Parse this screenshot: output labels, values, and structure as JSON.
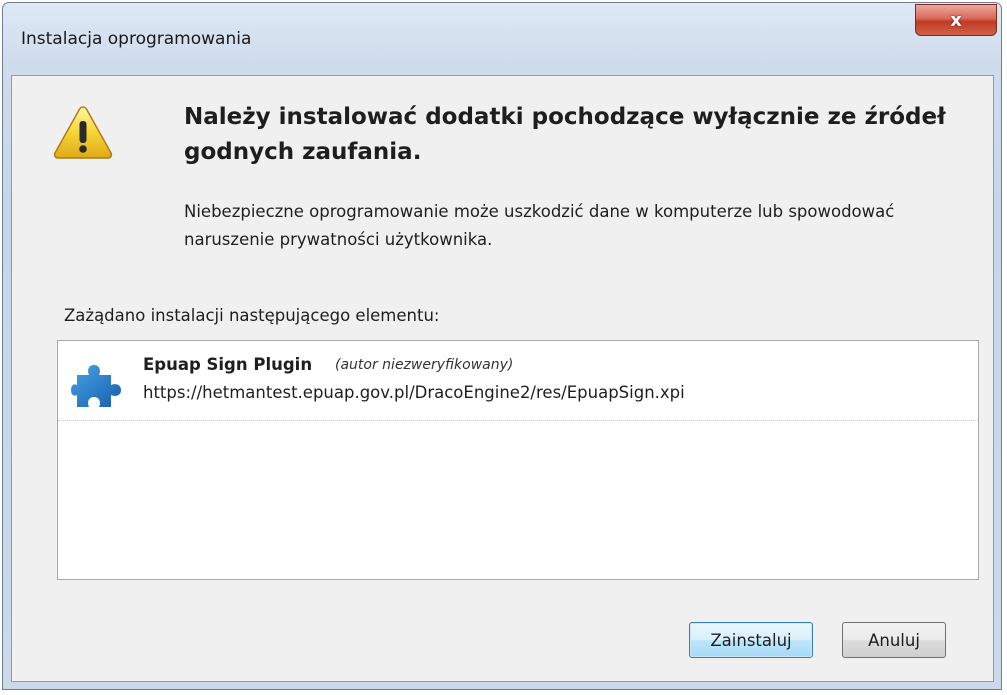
{
  "window": {
    "title": "Instalacja oprogramowania",
    "close_label": "x"
  },
  "warning": {
    "icon": "warning-icon",
    "heading": "Należy instalować dodatki pochodzące wyłącznie ze źródeł godnych zaufania.",
    "description": "Niebezpieczne oprogramowanie może uszkodzić dane w komputerze lub spowodować naruszenie prywatności użytkownika."
  },
  "request": {
    "label": "Zażądano instalacji następującego elementu:",
    "items": [
      {
        "icon": "puzzle-piece-icon",
        "name": "Epuap Sign Plugin",
        "author_note": "(autor niezweryfikowany)",
        "url": "https://hetmantest.epuap.gov.pl/DracoEngine2/res/EpuapSign.xpi"
      }
    ]
  },
  "buttons": {
    "install": "Zainstaluj",
    "cancel": "Anuluj"
  },
  "colors": {
    "close_button": "#c94a36",
    "install_border": "#3c7fb1",
    "puzzle": "#1f6fb8",
    "warning_fill": "#f5d634"
  }
}
